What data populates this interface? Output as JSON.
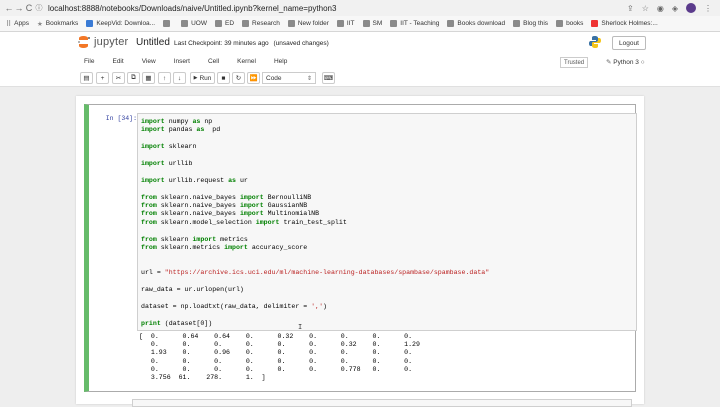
{
  "browser": {
    "url": "localhost:8888/notebooks/Downloads/naive/Untitled.ipynb?kernel_name=python3",
    "back": "←",
    "forward": "→",
    "reload": "C"
  },
  "bookmarks": [
    {
      "label": "Apps",
      "icon": "apps-icon"
    },
    {
      "label": "Bookmarks",
      "icon": "star-icon"
    },
    {
      "label": "KeepVid: Downloa...",
      "icon": "keepvid-icon"
    },
    {
      "label": "",
      "icon": "folder-icon"
    },
    {
      "label": "UOW",
      "icon": "folder-icon"
    },
    {
      "label": "ED",
      "icon": "folder-icon"
    },
    {
      "label": "Research",
      "icon": "folder-icon"
    },
    {
      "label": "New folder",
      "icon": "folder-icon"
    },
    {
      "label": "IIT",
      "icon": "folder-icon"
    },
    {
      "label": "SM",
      "icon": "folder-icon"
    },
    {
      "label": "IIT - Teaching",
      "icon": "folder-icon"
    },
    {
      "label": "Books download",
      "icon": "folder-icon"
    },
    {
      "label": "Blog this",
      "icon": "folder-icon"
    },
    {
      "label": "books",
      "icon": "folder-icon"
    },
    {
      "label": "Sherlock Holmes:...",
      "icon": "youtube-icon"
    }
  ],
  "jupyter": {
    "logo_text": "jupyter",
    "notebook_title": "Untitled",
    "checkpoint": "Last Checkpoint: 39 minutes ago",
    "save_status": "(unsaved changes)",
    "logout_label": "Logout",
    "trusted_label": "Trusted",
    "kernel_label": "Python 3"
  },
  "menu": [
    "File",
    "Edit",
    "View",
    "Insert",
    "Cell",
    "Kernel",
    "Help"
  ],
  "toolbar": {
    "run_label": "Run",
    "cell_type": "Code"
  },
  "cell": {
    "prompt": "In [34]:",
    "output_lines": [
      "[  0.      0.64    0.64    0.      0.32    0.      0.      0.      0.",
      "   0.      0.      0.      0.      0.      0.      0.32    0.      1.29",
      "   1.93    0.      0.96    0.      0.      0.      0.      0.      0.",
      "   0.      0.      0.      0.      0.      0.      0.      0.      0.",
      "   0.      0.      0.      0.      0.      0.      0.778   0.      0.",
      "   3.756  61.    278.      1.  ]"
    ]
  },
  "colors": {
    "cell_selected_border": "#66bb6a",
    "prompt_color": "#303f9f",
    "keyword_color": "#008000",
    "string_color": "#ba2121",
    "jupyter_orange": "#f37726"
  }
}
